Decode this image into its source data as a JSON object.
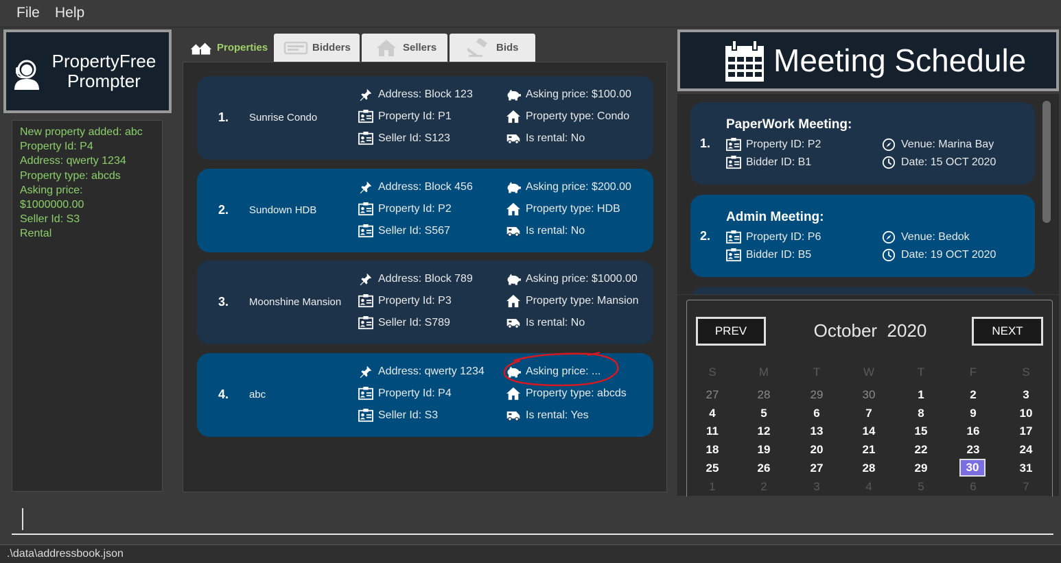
{
  "menu": {
    "file": "File",
    "help": "Help"
  },
  "app": {
    "title_line1": "PropertyFree",
    "title_line2": "Prompter"
  },
  "result": {
    "lines": [
      "New property added: abc",
      "Property Id: P4",
      "Address: qwerty 1234",
      "Property type: abcds",
      "Asking price:",
      "$1000000.00",
      "Seller Id: S3",
      "Rental"
    ]
  },
  "tabs": [
    {
      "label": "Properties",
      "active": true
    },
    {
      "label": "Bidders",
      "active": false
    },
    {
      "label": "Sellers",
      "active": false
    },
    {
      "label": "Bids",
      "active": false
    }
  ],
  "properties": [
    {
      "index": "1.",
      "name": "Sunrise Condo",
      "address": "Address: Block 123",
      "property_id": "Property Id: P1",
      "seller_id": "Seller Id: S123",
      "asking_price": "Asking price: $100.00",
      "property_type": "Property type: Condo",
      "is_rental": "Is rental: No"
    },
    {
      "index": "2.",
      "name": "Sundown HDB",
      "address": "Address: Block 456",
      "property_id": "Property Id: P2",
      "seller_id": "Seller Id: S567",
      "asking_price": "Asking price: $200.00",
      "property_type": "Property type: HDB",
      "is_rental": "Is rental: No"
    },
    {
      "index": "3.",
      "name": "Moonshine Mansion",
      "address": "Address: Block 789",
      "property_id": "Property Id: P3",
      "seller_id": "Seller Id: S789",
      "asking_price": "Asking price: $1000.00",
      "property_type": "Property type: Mansion",
      "is_rental": "Is rental: No"
    },
    {
      "index": "4.",
      "name": "abc",
      "address": "Address: qwerty 1234",
      "property_id": "Property Id: P4",
      "seller_id": "Seller Id: S3",
      "asking_price": "Asking price: ...",
      "property_type": "Property type: abcds",
      "is_rental": "Is rental: Yes"
    }
  ],
  "schedule": {
    "title": "Meeting Schedule",
    "meetings": [
      {
        "index": "1.",
        "title": "PaperWork Meeting:",
        "property_id": "Property ID: P2",
        "bidder_id": "Bidder ID: B1",
        "venue": "Venue: Marina Bay",
        "date": "Date: 15 OCT 2020"
      },
      {
        "index": "2.",
        "title": "Admin Meeting:",
        "property_id": "Property ID: P6",
        "bidder_id": "Bidder ID: B5",
        "venue": "Venue: Bedok",
        "date": "Date: 19 OCT 2020"
      }
    ]
  },
  "calendar": {
    "prev": "PREV",
    "next": "NEXT",
    "month": "October",
    "year": "2020",
    "weekdays": [
      "S",
      "M",
      "T",
      "W",
      "T",
      "F",
      "S"
    ],
    "rows": [
      [
        "27",
        "28",
        "29",
        "30",
        "1",
        "2",
        "3"
      ],
      [
        "4",
        "5",
        "6",
        "7",
        "8",
        "9",
        "10"
      ],
      [
        "11",
        "12",
        "13",
        "14",
        "15",
        "16",
        "17"
      ],
      [
        "18",
        "19",
        "20",
        "21",
        "22",
        "23",
        "24"
      ],
      [
        "25",
        "26",
        "27",
        "28",
        "29",
        "30",
        "31"
      ],
      [
        "1",
        "2",
        "3",
        "4",
        "5",
        "6",
        "7"
      ]
    ],
    "today": "30"
  },
  "status": {
    "path": ".\\data\\addressbook.json"
  },
  "colors": {
    "accent_green": "#9fd06a",
    "card_dark": "#1d3349",
    "card_blue": "#004d7d",
    "today": "#7b6ee0"
  }
}
